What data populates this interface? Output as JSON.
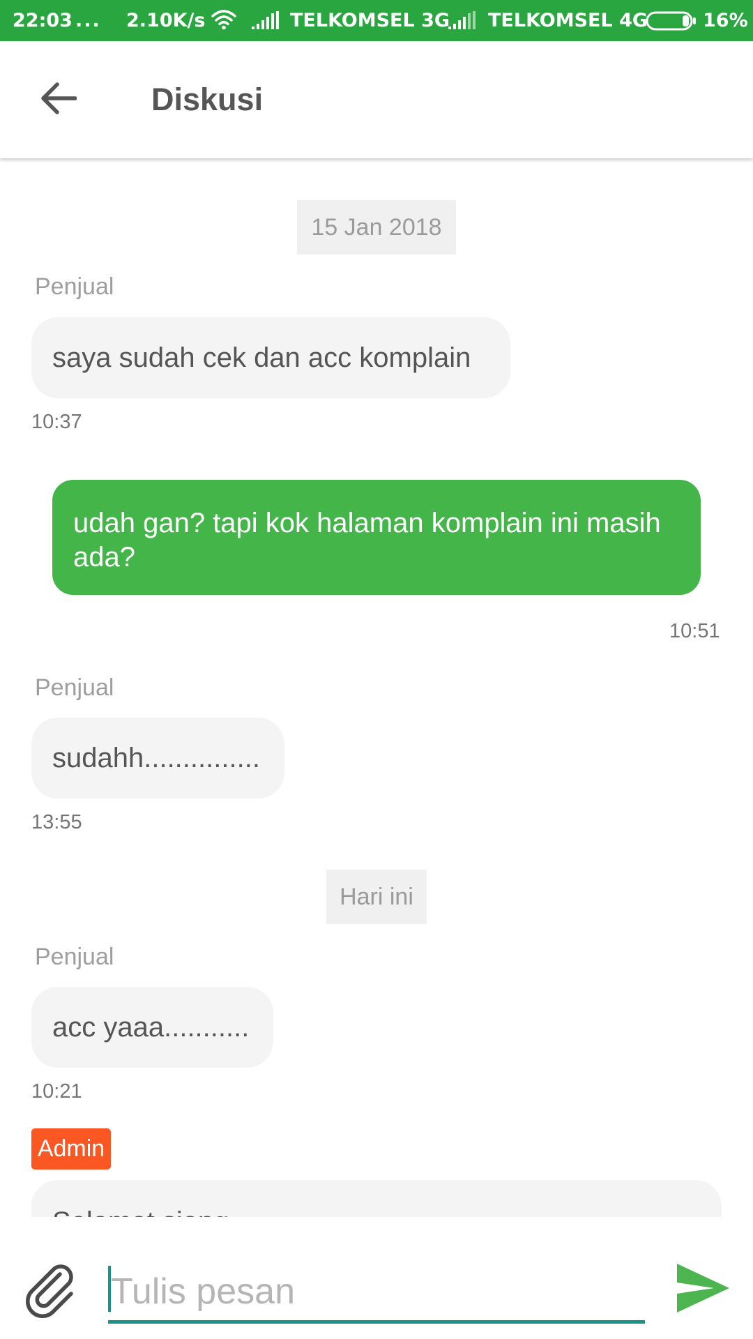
{
  "status_bar": {
    "time": "22:03",
    "notification_dots": "...",
    "network_speed": "2.10K/s",
    "carrier_1": "TELKOMSEL 3G",
    "carrier_2": "TELKOMSEL 4G",
    "battery_percent": "16%",
    "battery_level": 0.16,
    "background_color": "#2aa640"
  },
  "app_bar": {
    "title": "Diskusi",
    "back_icon": "arrow-left-icon"
  },
  "chat": {
    "date_separators": [
      "15 Jan 2018",
      "Hari ini"
    ],
    "messages": [
      {
        "sender": "Penjual",
        "text": "saya sudah cek dan acc komplain",
        "time": "10:37",
        "direction": "incoming"
      },
      {
        "sender": "",
        "text": "udah gan? tapi kok halaman komplain ini masih ada?",
        "time": "10:51",
        "direction": "outgoing"
      },
      {
        "sender": "Penjual",
        "text": "sudahh...............",
        "time": "13:55",
        "direction": "incoming"
      },
      {
        "sender": "Penjual",
        "text": "acc yaaa...........",
        "time": "10:21",
        "direction": "incoming"
      },
      {
        "sender": "Admin",
        "text": "Selamat siang",
        "time": "",
        "direction": "incoming"
      }
    ],
    "colors": {
      "outgoing_bubble": "#43b549",
      "incoming_bubble": "#f4f4f4",
      "admin_badge": "#fb5722"
    }
  },
  "composer": {
    "placeholder": "Tulis pesan",
    "value": "",
    "attach_icon": "paperclip-icon",
    "send_icon": "send-icon",
    "accent_color": "#169488",
    "send_color": "#4cb54f"
  }
}
